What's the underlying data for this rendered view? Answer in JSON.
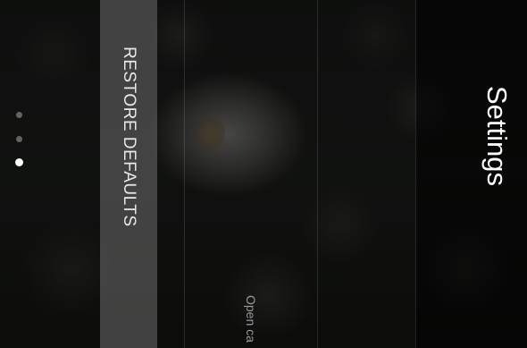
{
  "header": {
    "title": "Settings"
  },
  "actions": {
    "restore_defaults_label": "RESTORE DEFAULTS"
  },
  "list": {
    "partial_item_label": "Open ca"
  },
  "pager": {
    "page_count": 3,
    "active_page": 3
  },
  "colors": {
    "title_text": "#ffffff",
    "restore_panel": "#808080",
    "background": "#0d0d0d"
  }
}
